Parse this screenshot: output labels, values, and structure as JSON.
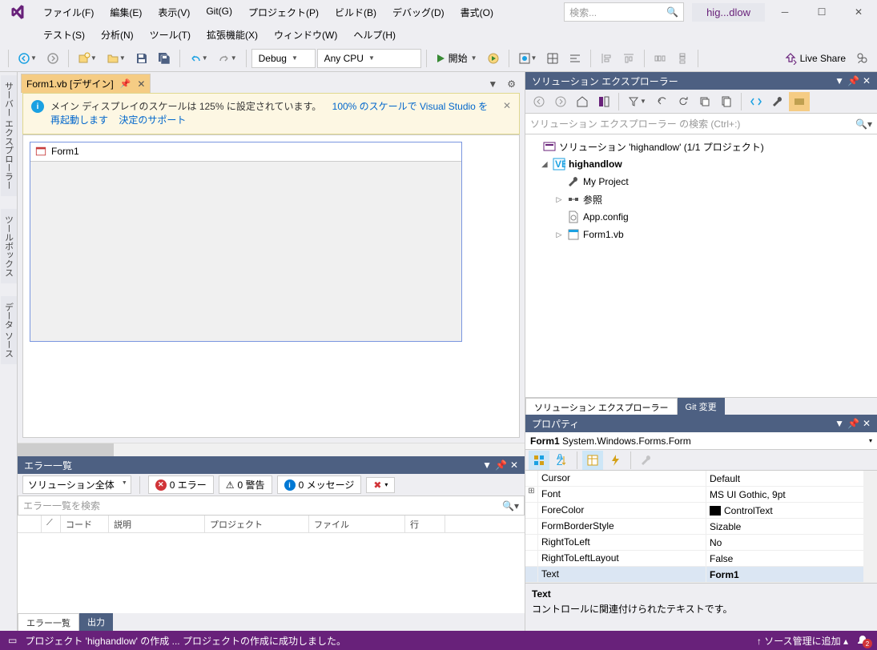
{
  "title_solution": "hig...dlow",
  "menu": {
    "row1": [
      "ファイル(F)",
      "編集(E)",
      "表示(V)",
      "Git(G)",
      "プロジェクト(P)",
      "ビルド(B)",
      "デバッグ(D)",
      "書式(O)"
    ],
    "row2": [
      "テスト(S)",
      "分析(N)",
      "ツール(T)",
      "拡張機能(X)",
      "ウィンドウ(W)",
      "ヘルプ(H)"
    ]
  },
  "search_placeholder": "検索...",
  "toolbar": {
    "config": "Debug",
    "platform": "Any CPU",
    "start": "開始",
    "liveshare": "Live Share"
  },
  "left_tabs": [
    "サーバー エクスプローラー",
    "ツールボックス",
    "データ ソース"
  ],
  "doc_tab": "Form1.vb [デザイン]",
  "info": {
    "text": "メイン ディスプレイのスケールは 125% に設定されています。",
    "link1": "100% のスケールで Visual Studio を再起動します",
    "link2": "決定のサポート"
  },
  "form_title": "Form1",
  "errorlist": {
    "title": "エラー一覧",
    "scope": "ソリューション全体",
    "errors": "0 エラー",
    "warnings": "0 警告",
    "messages": "0 メッセージ",
    "search_placeholder": "エラー一覧を検索",
    "columns": [
      "コード",
      "説明",
      "プロジェクト",
      "ファイル",
      "行"
    ]
  },
  "bottom_tabs": {
    "errorlist": "エラー一覧",
    "output": "出力"
  },
  "solution_explorer": {
    "title": "ソリューション エクスプローラー",
    "search_placeholder": "ソリューション エクスプローラー の検索 (Ctrl+:)",
    "root": "ソリューション 'highandlow' (1/1 プロジェクト)",
    "project": "highandlow",
    "items": [
      "My Project",
      "参照",
      "App.config",
      "Form1.vb"
    ],
    "tab_sln": "ソリューション エクスプローラー",
    "tab_git": "Git 変更"
  },
  "properties": {
    "title": "プロパティ",
    "object": "Form1",
    "type": "System.Windows.Forms.Form",
    "rows": [
      {
        "name": "Cursor",
        "value": "Default"
      },
      {
        "name": "Font",
        "value": "MS UI Gothic, 9pt",
        "expand": true
      },
      {
        "name": "ForeColor",
        "value": "ControlText",
        "color": "#000000"
      },
      {
        "name": "FormBorderStyle",
        "value": "Sizable"
      },
      {
        "name": "RightToLeft",
        "value": "No"
      },
      {
        "name": "RightToLeftLayout",
        "value": "False"
      },
      {
        "name": "Text",
        "value": "Form1",
        "selected": true,
        "bold": true
      }
    ],
    "desc_title": "Text",
    "desc_text": "コントロールに関連付けられたテキストです。"
  },
  "statusbar": {
    "text": "プロジェクト 'highandlow' の作成 ... プロジェクトの作成に成功しました。",
    "source": "ソース管理に追加",
    "notif_count": "2"
  }
}
